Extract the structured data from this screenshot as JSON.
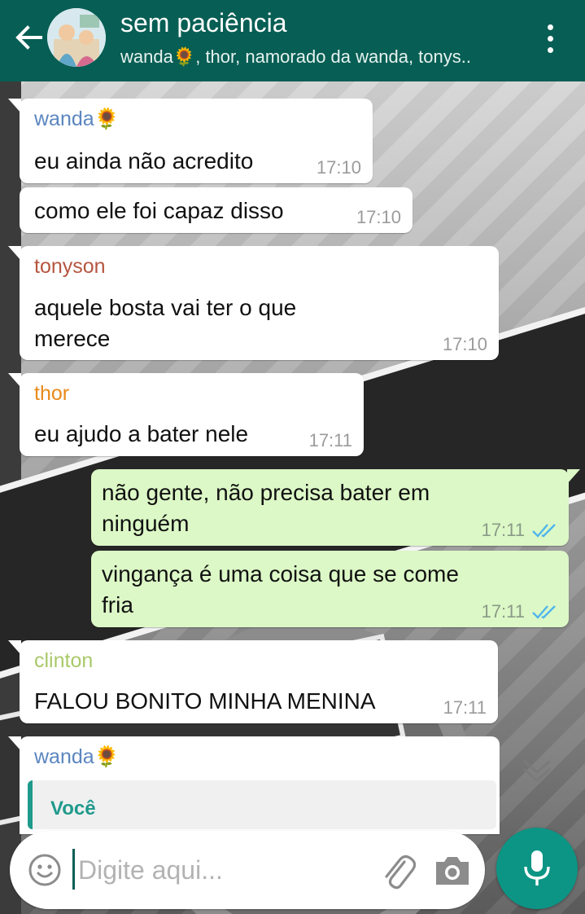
{
  "header": {
    "back_icon": "arrow-left-icon",
    "title": "sem paciência",
    "members": "wanda🌻, thor, namorado da wanda, tonys..",
    "menu_icon": "more-vertical-icon",
    "background_color": "#075e54"
  },
  "messages": [
    {
      "sender": "wanda🌻",
      "sender_color": "#5b86c0",
      "text": "eu ainda não acredito",
      "time": "17:10",
      "direction": "in"
    },
    {
      "sender": "",
      "text": "como ele foi capaz disso",
      "time": "17:10",
      "direction": "in"
    },
    {
      "sender": "tonyson",
      "sender_color": "#b5553f",
      "text_lines": [
        "aquele bosta vai ter o que",
        "merece"
      ],
      "time": "17:10",
      "direction": "in"
    },
    {
      "sender": "thor",
      "sender_color": "#e88a1a",
      "text": "eu ajudo a bater nele",
      "time": "17:11",
      "direction": "in"
    },
    {
      "sender": "",
      "text_lines": [
        "não gente, não precisa bater em",
        "ninguém"
      ],
      "time": "17:11",
      "direction": "out",
      "status": "read"
    },
    {
      "sender": "",
      "text_lines": [
        "vingança é uma coisa que se come",
        "fria"
      ],
      "time": "17:11",
      "direction": "out",
      "status": "read"
    },
    {
      "sender": "clinton",
      "sender_color": "#a9c96a",
      "text": "FALOU BONITO MINHA MENINA",
      "time": "17:11",
      "direction": "in"
    },
    {
      "sender": "wanda🌻",
      "sender_color": "#5b86c0",
      "quote_author": "Você",
      "direction": "in"
    }
  ],
  "composer": {
    "placeholder": "Digite aqui...",
    "value": "",
    "emoji_icon": "emoji-icon",
    "attach_icon": "paperclip-icon",
    "camera_icon": "camera-icon",
    "mic_icon": "microphone-icon",
    "accent_color": "#0c9585"
  },
  "colors": {
    "incoming_bubble": "#ffffff",
    "outgoing_bubble": "#dcf8c6",
    "read_ticks": "#4fb6ec"
  }
}
